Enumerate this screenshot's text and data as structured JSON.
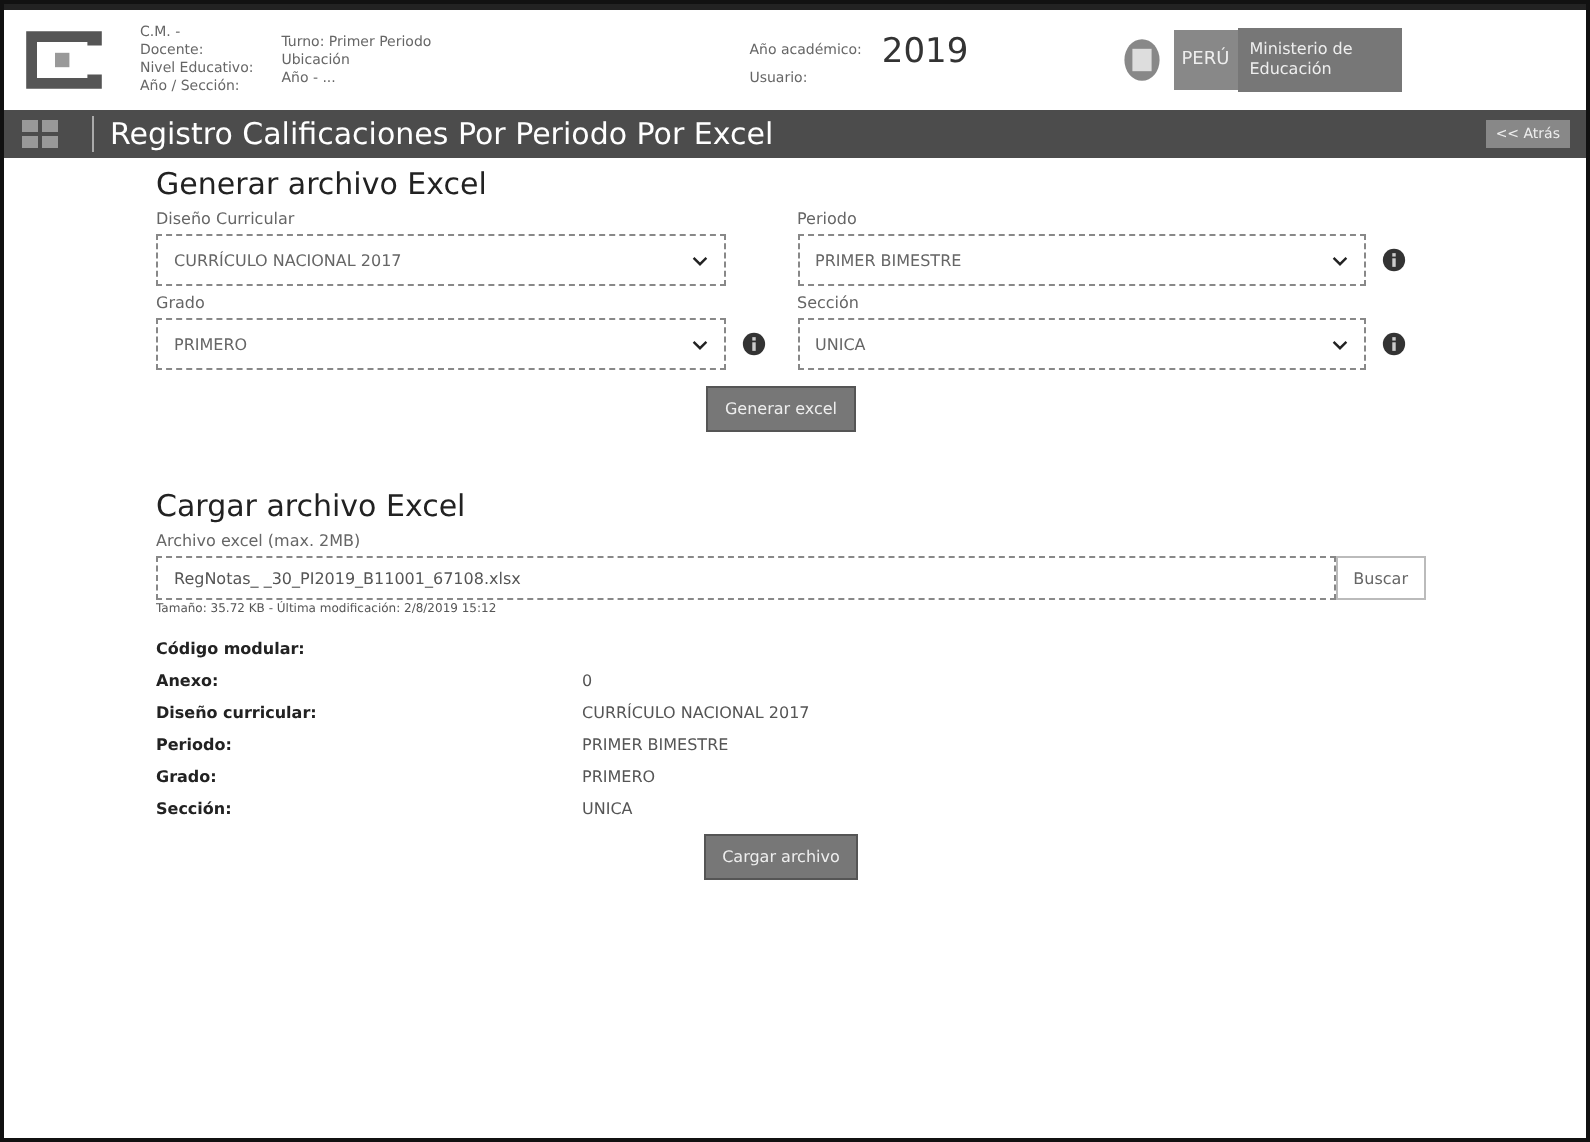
{
  "header": {
    "school_lines": [
      "C.M. -",
      "Docente:",
      "Nivel Educativo:",
      "Año / Sección:"
    ],
    "middle_lines": [
      "Turno: Primer Periodo",
      "Ubicación",
      "Año - ..."
    ],
    "year_label": "Año académico:",
    "year": "2019",
    "user_label": "Usuario:",
    "country": "PERÚ",
    "ministry": "Ministerio de Educación"
  },
  "title_bar": {
    "title": "Registro Calificaciones Por Periodo Por Excel",
    "back": "<< Atrás"
  },
  "generate": {
    "heading": "Generar archivo Excel",
    "fields": [
      {
        "label": "Diseño Curricular",
        "value": "CURRÍCULO NACIONAL 2017",
        "info": false
      },
      {
        "label": "Periodo",
        "value": "PRIMER BIMESTRE",
        "info": true
      },
      {
        "label": "Grado",
        "value": "PRIMERO",
        "info": true
      },
      {
        "label": "Sección",
        "value": "UNICA",
        "info": true
      }
    ],
    "button": "Generar excel"
  },
  "upload": {
    "heading": "Cargar archivo Excel",
    "file_label": "Archivo excel (max. 2MB)",
    "file_name": "RegNotas_ _30_PI2019_B11001_67108.xlsx",
    "browse": "Buscar",
    "file_info": "Tamaño: 35.72 KB - Última modificación: 2/8/2019 15:12",
    "details": [
      {
        "label": "Código modular:"
      },
      {
        "label": "Anexo:",
        "value": "0"
      },
      {
        "label": "Diseño curricular:",
        "value": "CURRÍCULO NACIONAL 2017"
      },
      {
        "label": "Periodo:",
        "value": "PRIMER BIMESTRE"
      },
      {
        "label": "Grado:",
        "value": "PRIMERO"
      },
      {
        "label": "Sección:",
        "value": "UNICA"
      }
    ],
    "button": "Cargar archivo"
  }
}
